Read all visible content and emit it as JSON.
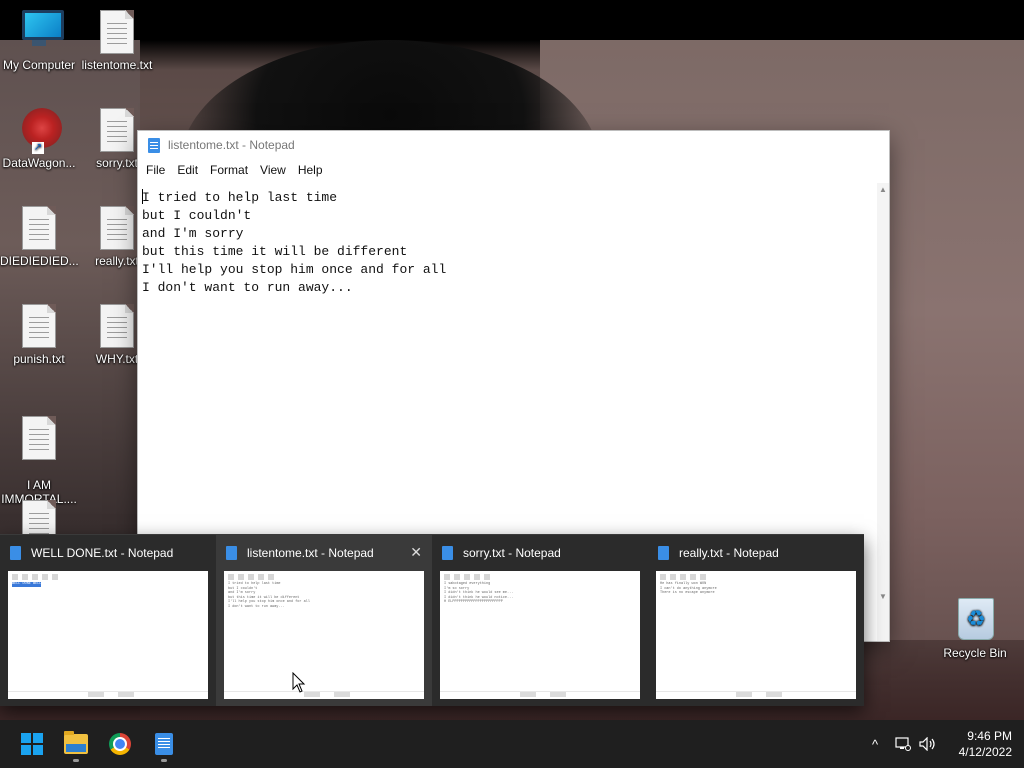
{
  "desktop": {
    "icons": [
      {
        "label": "My Computer",
        "type": "computer"
      },
      {
        "label": "listentome.txt",
        "type": "text"
      },
      {
        "label": "DataWagon...",
        "type": "shortcut"
      },
      {
        "label": "sorry.txt",
        "type": "text"
      },
      {
        "label": "DIEDIEDIED...",
        "type": "text"
      },
      {
        "label": "really.txt",
        "type": "text"
      },
      {
        "label": "punish.txt",
        "type": "text"
      },
      {
        "label": "WHY.txt",
        "type": "text"
      },
      {
        "label": "I AM\nIMMORTAL....",
        "type": "text"
      },
      {
        "label": "",
        "type": "text"
      },
      {
        "label": "Recycle Bin",
        "type": "recycle-bin"
      }
    ]
  },
  "notepad": {
    "title": "listentome.txt - Notepad",
    "menu": [
      "File",
      "Edit",
      "Format",
      "View",
      "Help"
    ],
    "lines": [
      "I tried to help last time",
      "but I couldn't",
      "and I'm sorry",
      "but this time it will be different",
      "I'll help you stop him once and for all",
      "I don't want to run away..."
    ]
  },
  "thumbnails": [
    {
      "title": "WELL DONE.txt - Notepad"
    },
    {
      "title": "listentome.txt - Notepad",
      "hovered": true
    },
    {
      "title": "sorry.txt - Notepad"
    },
    {
      "title": "really.txt - Notepad"
    }
  ],
  "taskbar": {
    "apps": [
      "start",
      "file-explorer",
      "chrome",
      "notepad"
    ],
    "tray_chevron": "^",
    "time": "9:46 PM",
    "date": "4/12/2022"
  },
  "colors": {
    "taskbar": "#1f1f1f",
    "accent": "#1aa3f0",
    "notepad_icon": "#3a8ee6"
  }
}
